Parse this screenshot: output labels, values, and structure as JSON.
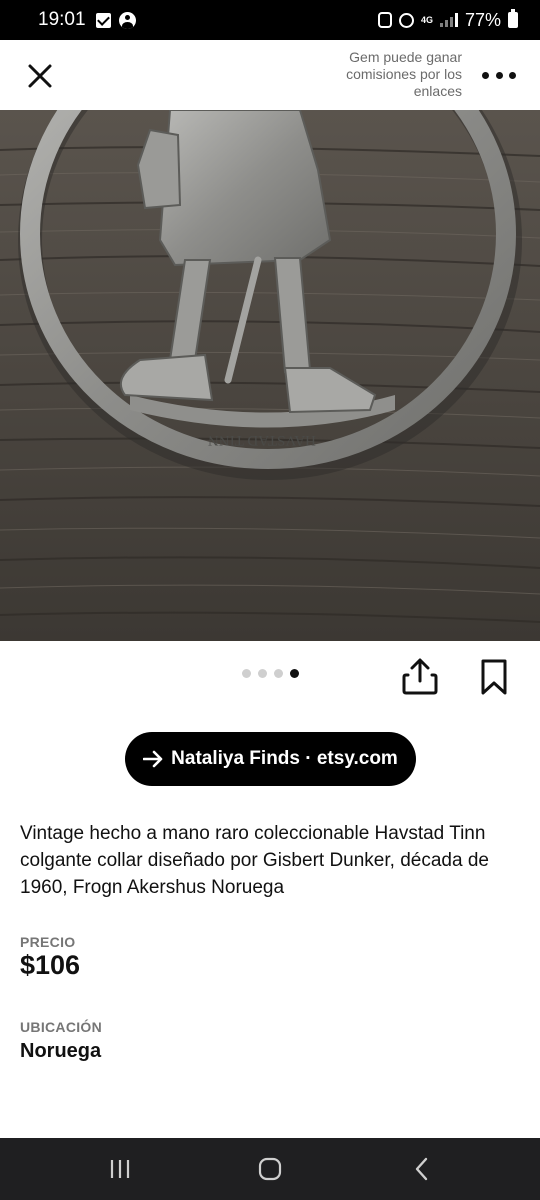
{
  "status_bar": {
    "time": "19:01",
    "network": "4G",
    "battery": "77%"
  },
  "header": {
    "affiliate_note": "Gem puede ganar comisiones por los enlaces",
    "close_icon": "close-icon",
    "more_icon": "more-options-icon"
  },
  "image": {
    "carousel_total": 4,
    "carousel_active": 4
  },
  "actions": {
    "share_icon": "share-icon",
    "save_icon": "bookmark-icon"
  },
  "source": {
    "label": "Nataliya Finds · etsy.com",
    "icon": "arrow-right-icon"
  },
  "product": {
    "description": "Vintage hecho a mano raro coleccionable Havstad Tinn colgante collar diseñado por Gisbert Dunker, década de 1960, Frogn Akershus Noruega",
    "engraving": "HAVSTAD TINN",
    "price_label": "PRECIO",
    "price": "$106",
    "location_label": "UBICACIÓN",
    "location": "Noruega"
  },
  "colors": {
    "pill_bg": "#000000",
    "label_gray": "#767676",
    "nav_bg": "#1f1f21"
  }
}
